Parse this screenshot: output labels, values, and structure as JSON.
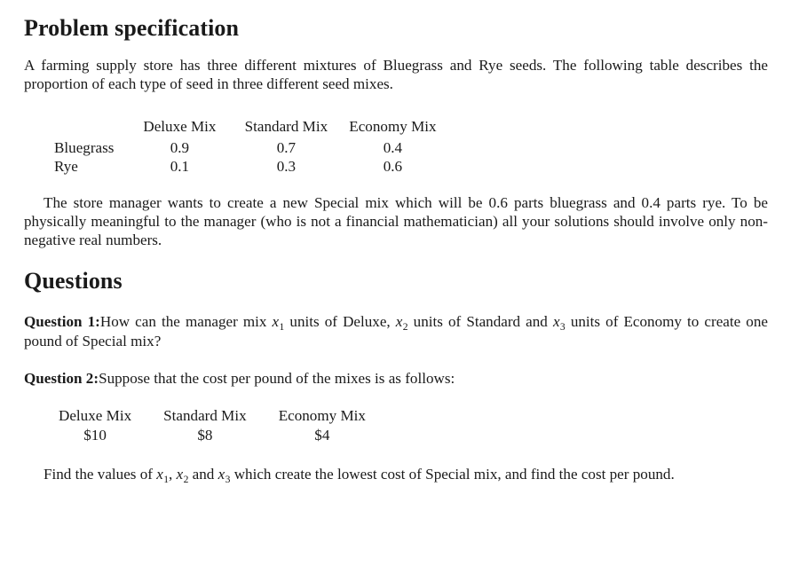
{
  "document": {
    "sections": {
      "problem_heading": "Problem specification",
      "questions_heading": "Questions"
    },
    "intro_paragraph": "A farming supply store has three different mixtures of Bluegrass and Rye seeds.  The following table describes the proportion of each type of seed in three different seed mixes.",
    "proportion_table": {
      "corner_label": "",
      "columns": [
        "Deluxe Mix",
        "Standard Mix",
        "Economy Mix"
      ],
      "rows": [
        {
          "label": "Bluegrass",
          "values": [
            "0.9",
            "0.7",
            "0.4"
          ]
        },
        {
          "label": "Rye",
          "values": [
            "0.1",
            "0.3",
            "0.6"
          ]
        }
      ]
    },
    "special_mix_paragraph": "The store manager wants to create a new Special mix which will be 0.6 parts bluegrass and 0.4 parts rye.  To be physically meaningful to the manager (who is not a financial mathematician) all your solutions should involve only non-negative real numbers.",
    "question1": {
      "label": "Question 1:",
      "text_part1": "How can the manager mix ",
      "var1": "x",
      "var1_sub": "1",
      "text_part2": " units of Deluxe, ",
      "var2": "x",
      "var2_sub": "2",
      "text_part3": " units of Standard and ",
      "var3": "x",
      "var3_sub": "3",
      "text_part4": " units of Economy to create one pound of Special mix?"
    },
    "question2": {
      "label": "Question 2:",
      "text": "Suppose that the cost per pound of the mixes is as follows:"
    },
    "cost_table": {
      "columns": [
        "Deluxe Mix",
        "Standard Mix",
        "Economy Mix"
      ],
      "values": [
        "$10",
        "$8",
        "$4"
      ]
    },
    "final_paragraph": {
      "text_part1": "Find the values of ",
      "var1": "x",
      "var1_sub": "1",
      "text_part2": ", ",
      "var2": "x",
      "var2_sub": "2",
      "text_part3": " and ",
      "var3": "x",
      "var3_sub": "3",
      "text_part4": " which create the lowest cost of Special mix, and find the cost per pound."
    }
  }
}
